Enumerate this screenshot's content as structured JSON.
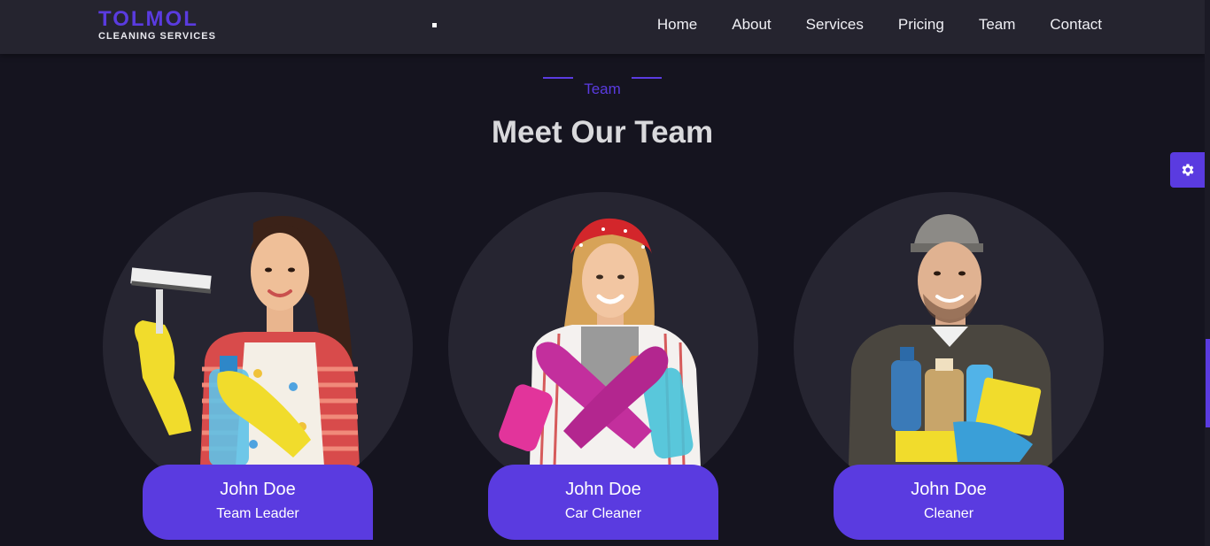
{
  "brand": {
    "name": "TOLMOL",
    "tagline": "CLEANING SERVICES"
  },
  "nav": {
    "links": [
      "Home",
      "About",
      "Services",
      "Pricing",
      "Team",
      "Contact"
    ]
  },
  "section": {
    "tag": "Team",
    "title": "Meet Our Team"
  },
  "team": [
    {
      "name": "John Doe",
      "role": "Team Leader"
    },
    {
      "name": "John Doe",
      "role": "Car Cleaner"
    },
    {
      "name": "John Doe",
      "role": "Cleaner"
    }
  ],
  "colors": {
    "accent": "#5a3be0",
    "background": "#15141f",
    "navbar": "#25242f",
    "circle": "#262531"
  },
  "icons": {
    "settings": "gear-icon"
  }
}
